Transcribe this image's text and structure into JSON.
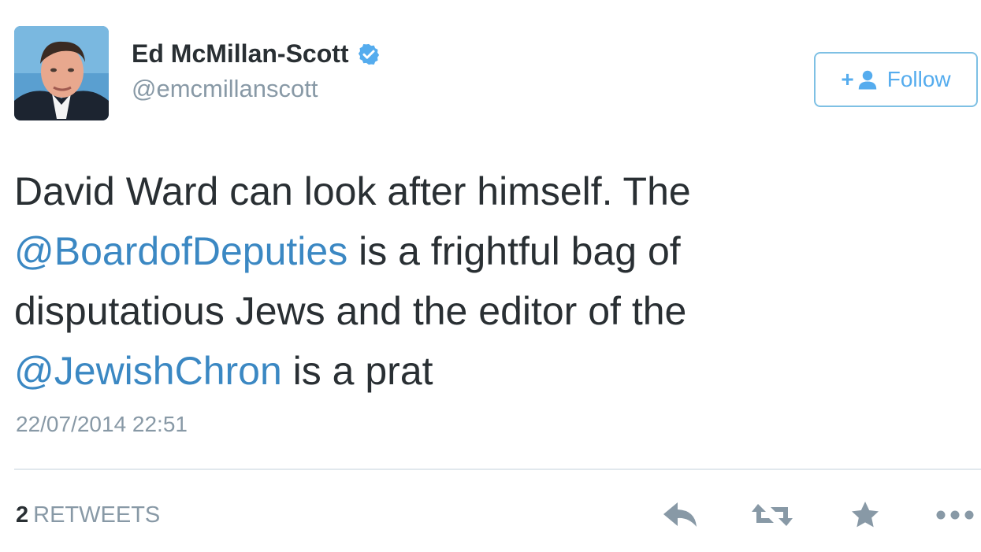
{
  "author": {
    "name": "Ed McMillan-Scott",
    "handle": "@emcmillanscott",
    "verified": true
  },
  "follow_button": {
    "icon_text": "+",
    "label": "Follow"
  },
  "tweet": {
    "lines": [
      [
        {
          "text": "David Ward can look after himself. The",
          "type": "text"
        }
      ],
      [
        {
          "text": "@BoardofDeputies",
          "type": "mention"
        },
        {
          "text": " is a frightful bag of",
          "type": "text"
        }
      ],
      [
        {
          "text": "disputatious Jews and the editor of the",
          "type": "text"
        }
      ],
      [
        {
          "text": "@JewishChron",
          "type": "mention"
        },
        {
          "text": " is a prat",
          "type": "text"
        }
      ]
    ],
    "timestamp": "22/07/2014 22:51"
  },
  "stats": {
    "retweet_count": "2",
    "retweet_label": "RETWEETS"
  },
  "actions": [
    "reply-icon",
    "retweet-icon",
    "favorite-icon",
    "more-icon"
  ],
  "colors": {
    "text": "#292f33",
    "secondary": "#8899a6",
    "link": "#3b88c3",
    "accent": "#55acee",
    "divider": "#e1e8ed",
    "action_icons": "#8899a6"
  }
}
